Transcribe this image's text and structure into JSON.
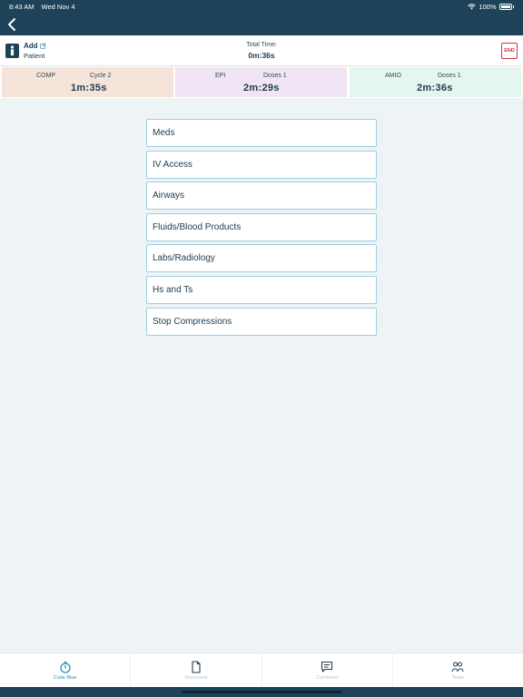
{
  "status": {
    "time": "8:43 AM",
    "date": "Wed Nov 4",
    "battery": "100%"
  },
  "patient": {
    "add_label": "Add",
    "sub_label": "Patient",
    "total_label": "Total Time:",
    "total_value": "0m:36s",
    "end_label": "END"
  },
  "timers": [
    {
      "name": "COMP",
      "extra": "Cycle 2",
      "value": "1m:35s",
      "color": "#f4e4d9"
    },
    {
      "name": "EPI",
      "extra": "Doses 1",
      "value": "2m:29s",
      "color": "#f1e4f5"
    },
    {
      "name": "AMIO",
      "extra": "Doses 1",
      "value": "2m:36s",
      "color": "#e4f7ee"
    }
  ],
  "actions": [
    "Meds",
    "IV Access",
    "Airways",
    "Fluids/Blood Products",
    "Labs/Radiology",
    "Hs and Ts",
    "Stop Compressions"
  ],
  "tabs": [
    {
      "label": "Code Blue",
      "icon": "stopwatch-icon",
      "active": true
    },
    {
      "label": "Document",
      "icon": "document-icon",
      "active": false
    },
    {
      "label": "Comment",
      "icon": "comment-icon",
      "active": false
    },
    {
      "label": "Team",
      "icon": "team-icon",
      "active": false
    }
  ],
  "colors": {
    "brand": "#1e4257",
    "accent": "#2c8fb8",
    "danger": "#d2363a"
  }
}
